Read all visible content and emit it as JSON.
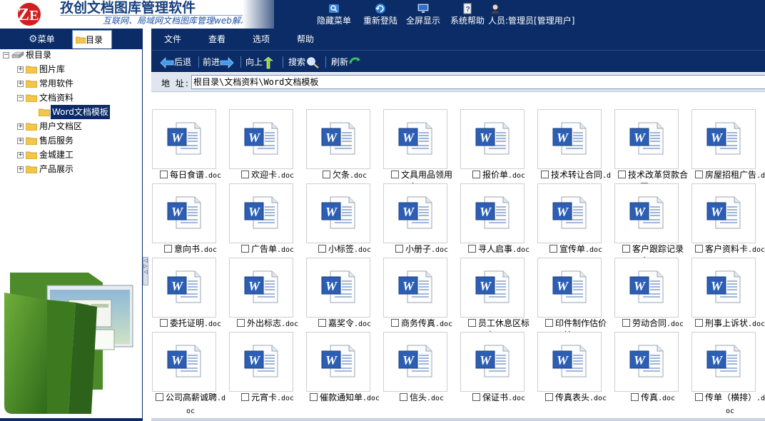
{
  "app": {
    "title": "孜创文档图库管理软件",
    "subtitle": "互联网、局域网文档图库管理web解决方案",
    "logo_text": "ZE"
  },
  "topnav": [
    {
      "label": "隐藏菜单",
      "icon": "hide-menu-icon"
    },
    {
      "label": "重新登陆",
      "icon": "relogin-icon"
    },
    {
      "label": "全屏显示",
      "icon": "fullscreen-icon"
    },
    {
      "label": "系统帮助",
      "icon": "help-icon"
    },
    {
      "label": "人员:管理员[管理用户]",
      "icon": "user-icon"
    }
  ],
  "left_tabs": {
    "menu": "菜单",
    "directory": "目录"
  },
  "tree": {
    "root": "根目录",
    "items": [
      "图片库",
      "常用软件",
      "文档资料",
      "Word文档模板",
      "用户文档区",
      "售后服务",
      "金城建工",
      "产品展示"
    ]
  },
  "menubar": [
    "文件",
    "查看",
    "选项",
    "帮助"
  ],
  "toolbar": {
    "back": "后退",
    "forward": "前进",
    "up": "向上",
    "search": "搜索",
    "refresh": "刷新"
  },
  "address": {
    "label": "地 址:",
    "value": "根目录\\文档资料\\Word文档模板"
  },
  "files": [
    {
      "name": "每日食谱",
      "ext": ".doc"
    },
    {
      "name": "欢迎卡",
      "ext": ".doc"
    },
    {
      "name": "欠条",
      "ext": ".doc"
    },
    {
      "name": "文具用品领用卡",
      "ext": ".doc"
    },
    {
      "name": "报价单",
      "ext": ".doc"
    },
    {
      "name": "技术转让合同",
      "ext": ".doc"
    },
    {
      "name": "技术改革贷款合同",
      "ext": ".doc"
    },
    {
      "name": "房屋招租广告",
      "ext": ".doc"
    },
    {
      "name": "意向书",
      "ext": ".doc"
    },
    {
      "name": "广告单",
      "ext": ".doc"
    },
    {
      "name": "小标签",
      "ext": ".doc"
    },
    {
      "name": "小册子",
      "ext": ".doc"
    },
    {
      "name": "寻人启事",
      "ext": ".doc"
    },
    {
      "name": "宣传单",
      "ext": ".doc"
    },
    {
      "name": "客户跟踪记录表",
      "ext": ".doc"
    },
    {
      "name": "客户资料卡",
      "ext": ".doc"
    },
    {
      "name": "委托证明",
      "ext": ".doc"
    },
    {
      "name": "外出标志",
      "ext": ".doc"
    },
    {
      "name": "嘉奖令",
      "ext": ".doc"
    },
    {
      "name": "商务传真",
      "ext": ".doc"
    },
    {
      "name": "员工休息区标志",
      "ext": ".doc"
    },
    {
      "name": "印件制作估价单",
      "ext": ".doc"
    },
    {
      "name": "劳动合同",
      "ext": ".doc"
    },
    {
      "name": "刑事上诉状",
      "ext": ".doc"
    },
    {
      "name": "公司高薪诚聘",
      "ext": ".doc"
    },
    {
      "name": "元宵卡",
      "ext": ".doc"
    },
    {
      "name": "催款通知单",
      "ext": ".doc"
    },
    {
      "name": "信头",
      "ext": ".doc"
    },
    {
      "name": "保证书",
      "ext": ".doc"
    },
    {
      "name": "传真表头",
      "ext": ".doc"
    },
    {
      "name": "传真",
      "ext": ".doc"
    },
    {
      "name": "传单（横排）",
      "ext": ".doc"
    }
  ],
  "colors": {
    "navy": "#0b2c66",
    "title": "#163f7d",
    "selection": "#0a2a6a"
  }
}
